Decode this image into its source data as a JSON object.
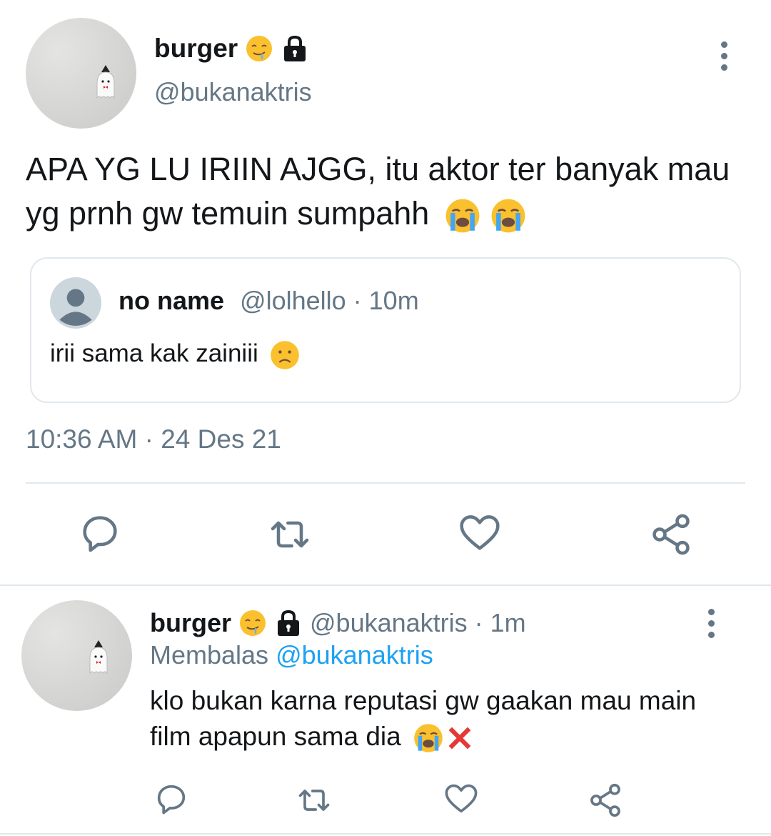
{
  "main_tweet": {
    "author_name": "burger",
    "author_handle": "@bukanaktris",
    "name_emoji": "drooling-face",
    "lock_icon": "lock-icon",
    "text": "APA YG LU IRIIN AJGG, itu aktor ter banyak mau yg prnh gw temuin sumpahh",
    "text_emojis": [
      "loudly-crying-face",
      "loudly-crying-face"
    ],
    "timestamp": "10:36 AM · 24 Des 21",
    "quoted": {
      "author_name": "no name",
      "author_handle": "@lolhello",
      "age": " · 10m",
      "text": "irii sama kak zainiii",
      "text_emoji": "frowning-face"
    }
  },
  "reply_tweet": {
    "author_name": "burger",
    "author_handle": "@bukanaktris",
    "age": " · 1m",
    "replying_prefix": "Membalas ",
    "replying_to": "@bukanaktris",
    "text": "klo bukan karna reputasi gw gaakan mau main film apapun sama dia",
    "text_emojis": [
      "loudly-crying-face",
      "cross-mark"
    ]
  },
  "actions": [
    "reply",
    "retweet",
    "like",
    "share"
  ],
  "colors": {
    "text": "#14171a",
    "muted": "#657786",
    "link": "#1da1f2",
    "border": "#e1e8ed"
  }
}
